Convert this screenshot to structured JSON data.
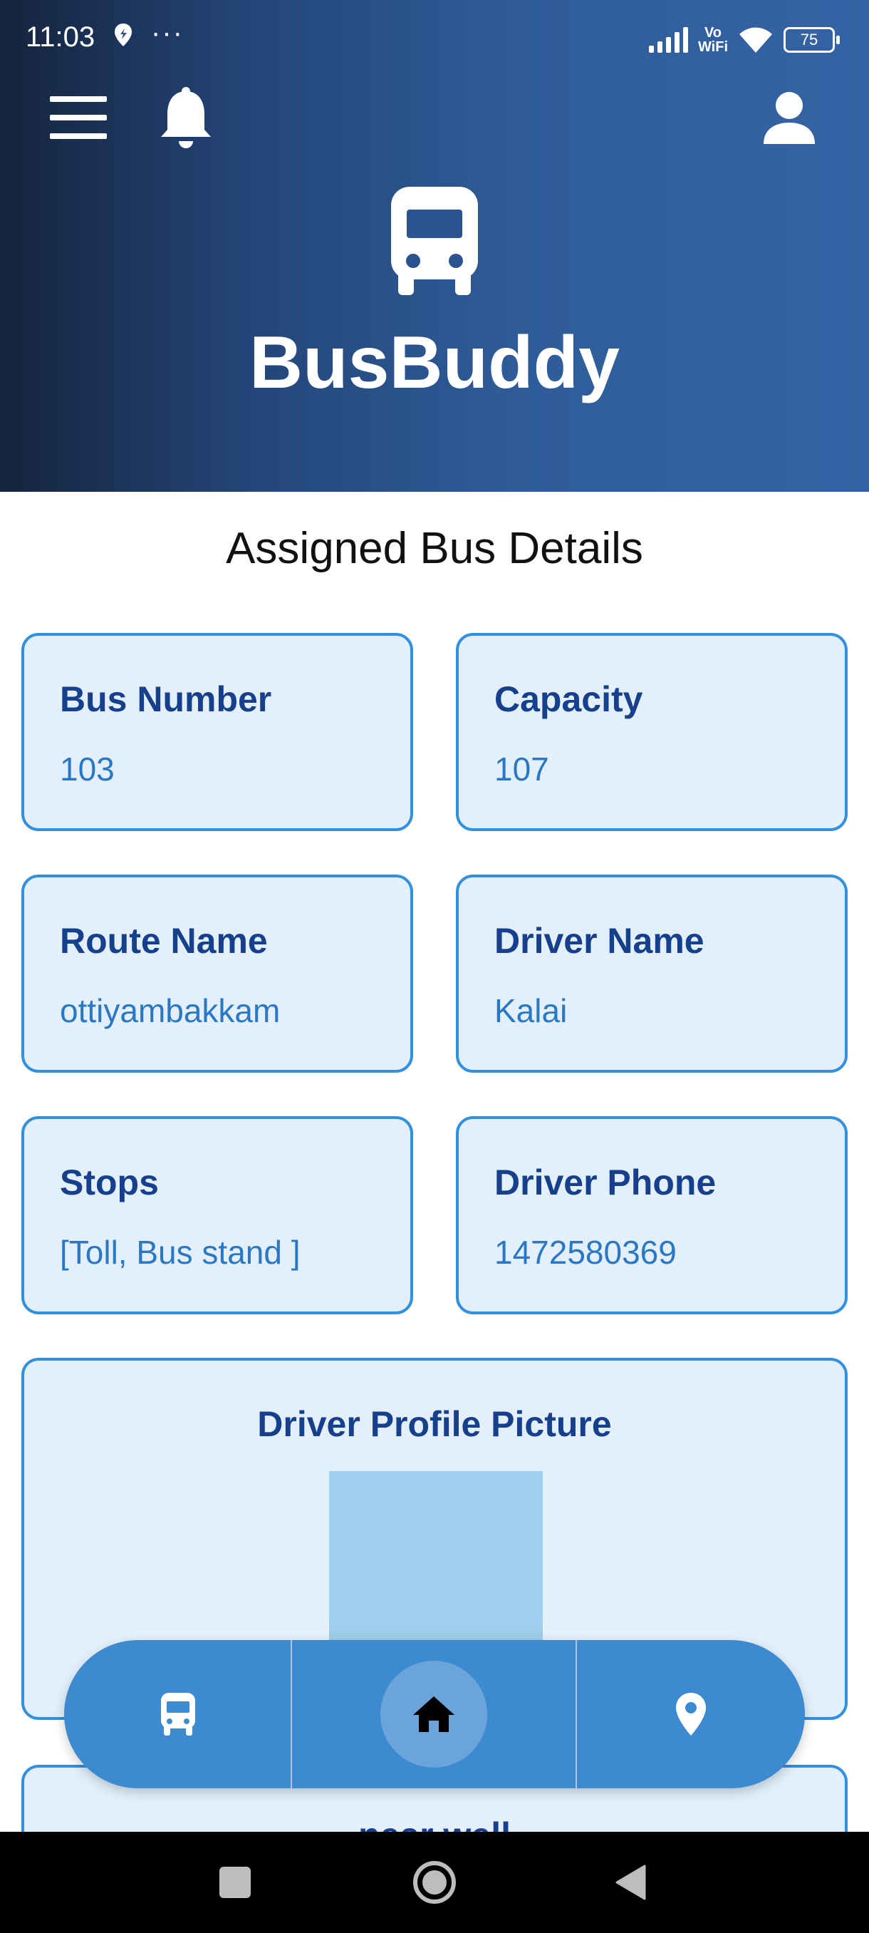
{
  "status_bar": {
    "time": "11:03",
    "dots": "···",
    "network_label_top": "Vo",
    "network_label_bottom": "WiFi",
    "battery": "75"
  },
  "header": {
    "app_title": "BusBuddy",
    "menu_icon": "hamburger-menu-icon",
    "notification_icon": "bell-icon",
    "profile_icon": "person-icon",
    "logo_icon": "bus-icon"
  },
  "main": {
    "section_title": "Assigned Bus Details",
    "cards": [
      {
        "label": "Bus Number",
        "value": "103"
      },
      {
        "label": "Capacity",
        "value": "107"
      },
      {
        "label": "Route Name",
        "value": "ottiyambakkam"
      },
      {
        "label": "Driver Name",
        "value": "Kalai"
      },
      {
        "label": "Stops",
        "value": "[Toll, Bus stand ]"
      },
      {
        "label": "Driver Phone",
        "value": "1472580369"
      }
    ],
    "profile_card": {
      "title": "Driver Profile Picture"
    },
    "next_card": {
      "text": "near well"
    }
  },
  "bottom_nav": {
    "items": [
      {
        "icon": "bus-icon"
      },
      {
        "icon": "home-icon",
        "active": true
      },
      {
        "icon": "location-pin-icon"
      }
    ]
  },
  "colors": {
    "header_dark": "#15243e",
    "header_light": "#3563a5",
    "card_border": "#3390dc",
    "card_bg": "#e3f0fb",
    "label_color": "#17408c",
    "value_color": "#2a78c4",
    "nav_bg": "#3e8ad0"
  }
}
